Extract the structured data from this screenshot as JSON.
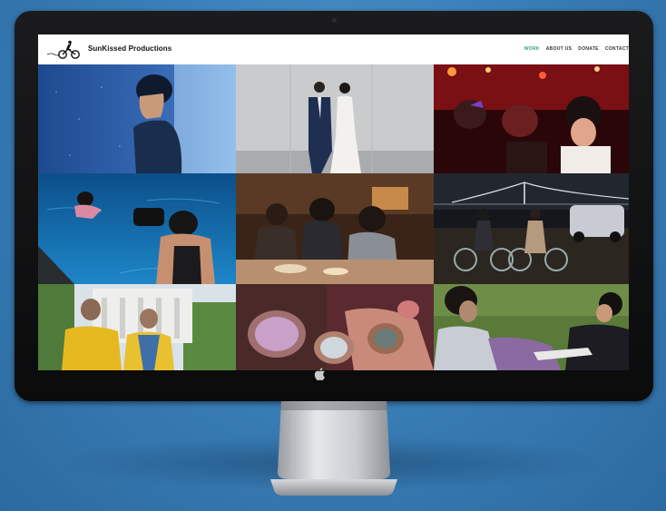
{
  "site": {
    "brand": "SunKissed Productions",
    "nav": [
      {
        "label": "WORK",
        "active": true
      },
      {
        "label": "ABOUT US",
        "active": false
      },
      {
        "label": "DONATE",
        "active": false
      },
      {
        "label": "CONTACT",
        "active": false
      }
    ],
    "accent_color": "#3a9a8c"
  },
  "icons": {
    "logo": "cyclist-logo-icon",
    "monitor_badge": "apple-logo-icon"
  }
}
